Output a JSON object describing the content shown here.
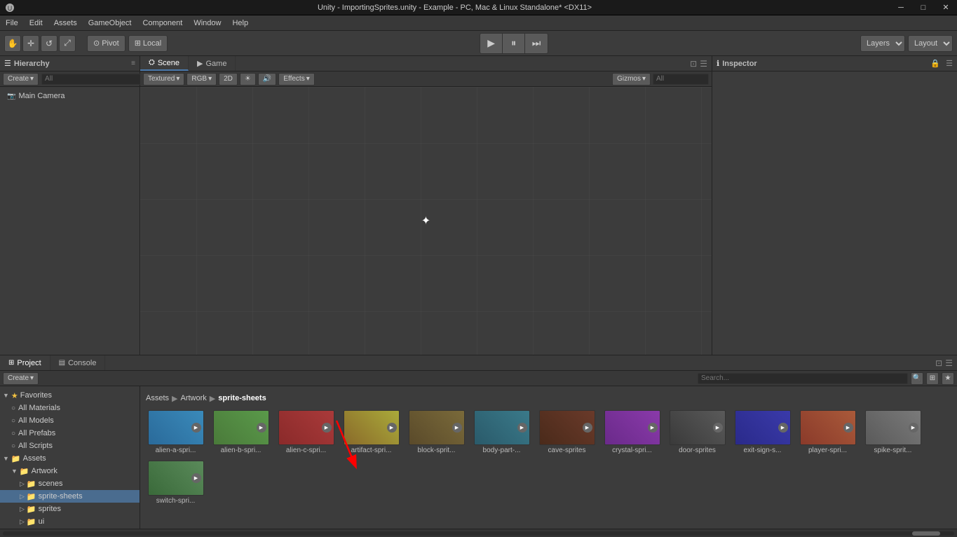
{
  "titlebar": {
    "title": "Unity - ImportingSprites.unity - Example - PC, Mac & Linux Standalone* <DX11>",
    "min": "─",
    "max": "□",
    "close": "✕"
  },
  "menubar": {
    "items": [
      "File",
      "Edit",
      "Assets",
      "GameObject",
      "Component",
      "Window",
      "Help"
    ]
  },
  "toolbar": {
    "pivot_label": "Pivot",
    "local_label": "Local",
    "layers_label": "Layers",
    "layout_label": "Layout"
  },
  "hierarchy": {
    "title": "Hierarchy",
    "create_label": "Create",
    "search_placeholder": "All",
    "items": [
      "Main Camera"
    ]
  },
  "scene": {
    "tabs": [
      "Scene",
      "Game"
    ],
    "active_tab": "Scene",
    "view_mode": "Textured",
    "color_mode": "RGB",
    "effects_label": "Effects",
    "gizmos_label": "Gizmos",
    "search_placeholder": "All"
  },
  "inspector": {
    "title": "Inspector"
  },
  "project": {
    "tabs": [
      "Project",
      "Console"
    ],
    "active_tab": "Project",
    "create_label": "Create",
    "breadcrumb": [
      "Assets",
      "Artwork",
      "sprite-sheets"
    ],
    "assets": [
      {
        "id": "alien-a",
        "label": "alien-a-spri...",
        "class": "sprite-alien-a"
      },
      {
        "id": "alien-b",
        "label": "alien-b-spri...",
        "class": "sprite-alien-b"
      },
      {
        "id": "alien-c",
        "label": "alien-c-spri...",
        "class": "sprite-alien-c"
      },
      {
        "id": "artifact",
        "label": "artifact-spri...",
        "class": "sprite-artifact"
      },
      {
        "id": "block",
        "label": "block-sprit...",
        "class": "sprite-block"
      },
      {
        "id": "body-part",
        "label": "body-part-...",
        "class": "sprite-body"
      },
      {
        "id": "cave",
        "label": "cave-sprites",
        "class": "sprite-cave"
      },
      {
        "id": "crystal",
        "label": "crystal-spri...",
        "class": "sprite-crystal"
      },
      {
        "id": "door",
        "label": "door-sprites",
        "class": "sprite-door"
      },
      {
        "id": "exit-sign",
        "label": "exit-sign-s...",
        "class": "sprite-exit"
      },
      {
        "id": "player",
        "label": "player-spri...",
        "class": "sprite-player"
      },
      {
        "id": "spike",
        "label": "spike-sprit...",
        "class": "sprite-spike"
      },
      {
        "id": "switch",
        "label": "switch-spri...",
        "class": "sprite-switch"
      }
    ]
  },
  "folder_tree": {
    "items": [
      {
        "id": "favorites",
        "label": "Favorites",
        "depth": 0,
        "icon": "★",
        "expanded": true
      },
      {
        "id": "all-materials",
        "label": "All Materials",
        "depth": 1,
        "icon": "○"
      },
      {
        "id": "all-models",
        "label": "All Models",
        "depth": 1,
        "icon": "○"
      },
      {
        "id": "all-prefabs",
        "label": "All Prefabs",
        "depth": 1,
        "icon": "○"
      },
      {
        "id": "all-scripts",
        "label": "All Scripts",
        "depth": 1,
        "icon": "○"
      },
      {
        "id": "assets-root",
        "label": "Assets",
        "depth": 0,
        "icon": "▼",
        "expanded": true
      },
      {
        "id": "artwork",
        "label": "Artwork",
        "depth": 1,
        "icon": "▼",
        "expanded": true
      },
      {
        "id": "scenes",
        "label": "scenes",
        "depth": 2,
        "icon": "▷"
      },
      {
        "id": "sprite-sheets",
        "label": "sprite-sheets",
        "depth": 2,
        "icon": "▷",
        "selected": true
      },
      {
        "id": "sprites",
        "label": "sprites",
        "depth": 2,
        "icon": "▷"
      },
      {
        "id": "ui",
        "label": "ui",
        "depth": 2,
        "icon": "▷"
      }
    ]
  }
}
